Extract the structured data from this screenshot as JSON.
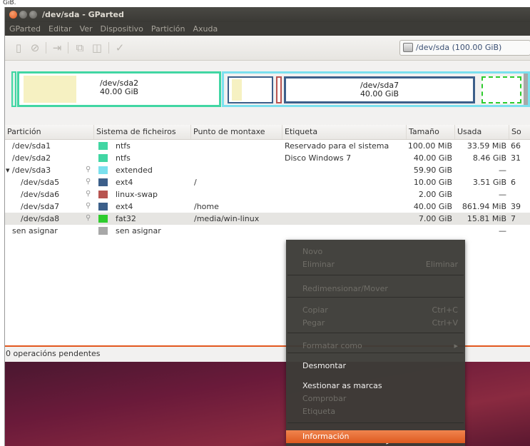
{
  "page_caption": "GiB.",
  "window": {
    "title": "/dev/sda - GParted"
  },
  "menubar": {
    "items": [
      "GParted",
      "Editar",
      "Ver",
      "Dispositivo",
      "Partición",
      "Axuda"
    ]
  },
  "toolbar": {
    "icons": [
      "new-icon",
      "delete-icon",
      "resize-icon",
      "copy-icon",
      "paste-icon",
      "apply-icon"
    ],
    "device_selector": "/dev/sda  (100.00 GiB)"
  },
  "partition_map": {
    "sda2": {
      "name": "/dev/sda2",
      "size": "40.00 GiB"
    },
    "sda7": {
      "name": "/dev/sda7",
      "size": "40.00 GiB"
    }
  },
  "table": {
    "columns": [
      "Partición",
      "Sistema de ficheiros",
      "Punto de montaxe",
      "Etiqueta",
      "Tamaño",
      "Usada",
      "So"
    ],
    "rows": [
      {
        "partition": "/dev/sda1",
        "filesystem": "ntfs",
        "mount": "",
        "label": "Reservado para el sistema",
        "size": "100.00 MiB",
        "used": "33.59 MiB",
        "other": "66",
        "color": "#41d6a3",
        "locked": false,
        "indent": 0,
        "expander": ""
      },
      {
        "partition": "/dev/sda2",
        "filesystem": "ntfs",
        "mount": "",
        "label": "Disco Windows 7",
        "size": "40.00 GiB",
        "used": "8.46 GiB",
        "other": "31",
        "color": "#41d6a3",
        "locked": false,
        "indent": 0,
        "expander": ""
      },
      {
        "partition": "/dev/sda3",
        "filesystem": "extended",
        "mount": "",
        "label": "",
        "size": "59.90 GiB",
        "used": "—",
        "other": "",
        "color": "#7be0ee",
        "locked": true,
        "indent": 0,
        "expander": "▾"
      },
      {
        "partition": "/dev/sda5",
        "filesystem": "ext4",
        "mount": "/",
        "label": "",
        "size": "10.00 GiB",
        "used": "3.51 GiB",
        "other": "6",
        "color": "#3c5f8a",
        "locked": true,
        "indent": 1,
        "expander": ""
      },
      {
        "partition": "/dev/sda6",
        "filesystem": "linux-swap",
        "mount": "",
        "label": "",
        "size": "2.00 GiB",
        "used": "—",
        "other": "",
        "color": "#b85450",
        "locked": true,
        "indent": 1,
        "expander": ""
      },
      {
        "partition": "/dev/sda7",
        "filesystem": "ext4",
        "mount": "/home",
        "label": "",
        "size": "40.00 GiB",
        "used": "861.94 MiB",
        "other": "39",
        "color": "#3c5f8a",
        "locked": true,
        "indent": 1,
        "expander": ""
      },
      {
        "partition": "/dev/sda8",
        "filesystem": "fat32",
        "mount": "/media/win-linux",
        "label": "",
        "size": "7.00 GiB",
        "used": "15.81 MiB",
        "other": "7",
        "color": "#2ecc2e",
        "locked": true,
        "indent": 1,
        "expander": ""
      },
      {
        "partition": "sen asignar",
        "filesystem": "sen asignar",
        "mount": "",
        "label": "",
        "size": "",
        "used": "—",
        "other": "",
        "color": "#a8a8a8",
        "locked": false,
        "indent": 0,
        "expander": ""
      }
    ]
  },
  "status": {
    "pending": "0 operacións pendentes"
  },
  "context_menu": {
    "items": [
      {
        "label": "Novo",
        "accel": "",
        "state": "disabled"
      },
      {
        "label": "Eliminar",
        "accel": "Eliminar",
        "state": "disabled"
      },
      {
        "label": "Redimensionar/Mover",
        "accel": "",
        "state": "disabled"
      },
      {
        "label": "Copiar",
        "accel": "Ctrl+C",
        "state": "disabled"
      },
      {
        "label": "Pegar",
        "accel": "Ctrl+V",
        "state": "disabled"
      },
      {
        "label": "Formatar como",
        "accel": "▸",
        "state": "disabled"
      },
      {
        "label": "Desmontar",
        "accel": "",
        "state": "enabled"
      },
      {
        "label": "Xestionar as marcas",
        "accel": "",
        "state": "enabled"
      },
      {
        "label": "Comprobar",
        "accel": "",
        "state": "disabled"
      },
      {
        "label": "Etiqueta",
        "accel": "",
        "state": "disabled"
      },
      {
        "label": "Información",
        "accel": "",
        "state": "highlighted"
      }
    ]
  }
}
